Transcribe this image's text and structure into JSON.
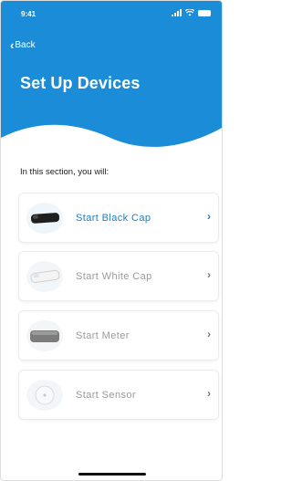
{
  "status_bar": {
    "time": "9:41"
  },
  "nav": {
    "back_label": "Back"
  },
  "page": {
    "title": "Set Up Devices",
    "intro": "In this section, you will:"
  },
  "steps": [
    {
      "label": "Start Black Cap",
      "icon": "black-cap-icon",
      "active": true
    },
    {
      "label": "Start White Cap",
      "icon": "white-cap-icon",
      "active": false
    },
    {
      "label": "Start Meter",
      "icon": "meter-icon",
      "active": false
    },
    {
      "label": "Start Sensor",
      "icon": "sensor-icon",
      "active": false
    }
  ],
  "colors": {
    "header": "#1a8cd8",
    "accent": "#1a7fc3",
    "inactive_text": "#9a9a9a"
  }
}
